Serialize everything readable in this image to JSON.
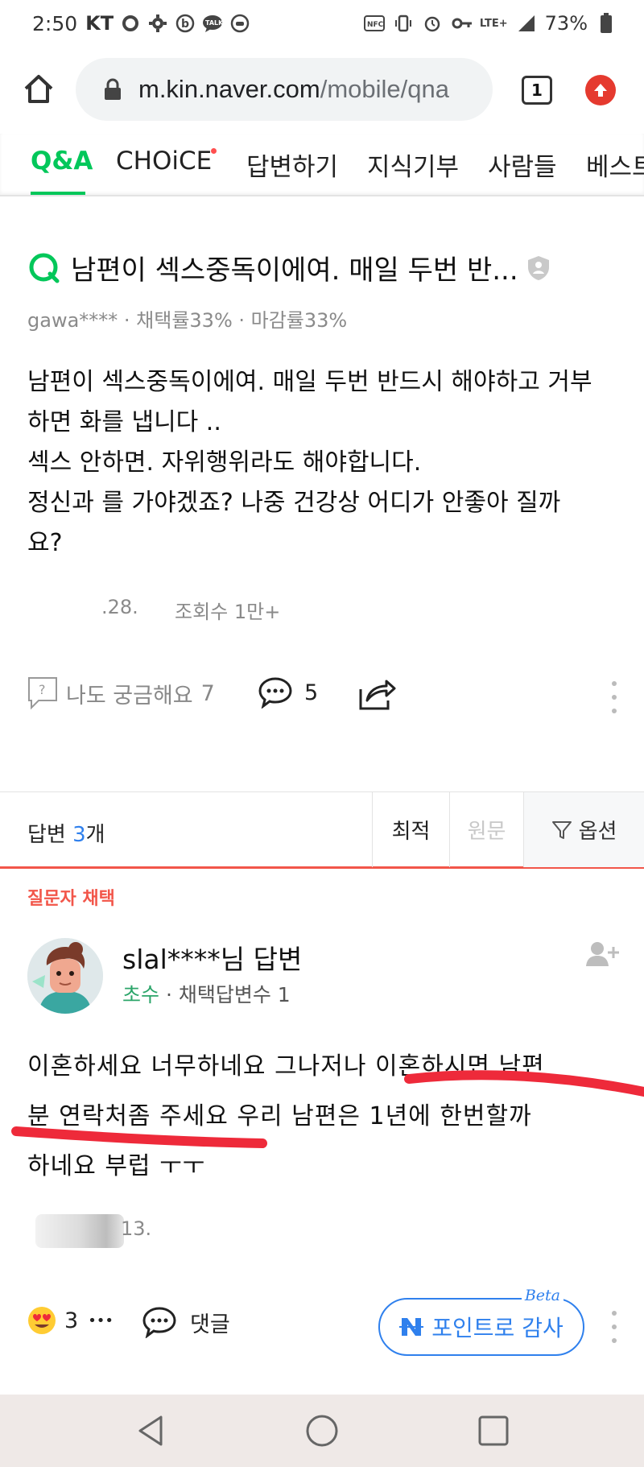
{
  "status_bar": {
    "time": "2:50",
    "carrier": "KT",
    "battery": "73%",
    "network": "LTE+"
  },
  "browser": {
    "url_host": "m.kin.naver.com",
    "url_path": "/mobile/qna",
    "tab_count": "1"
  },
  "tabs": [
    {
      "label": "Q&A"
    },
    {
      "label": "CHOiCE"
    },
    {
      "label": "답변하기"
    },
    {
      "label": "지식기부"
    },
    {
      "label": "사람들"
    },
    {
      "label": "베스트"
    }
  ],
  "question": {
    "title": "남편이 섹스중독이에여. 매일 두번 반...",
    "meta": "gawa**** · 채택률33% · 마감률33%",
    "body_lines": [
      "남편이 섹스중독이에여. 매일 두번 반드시 해야하고 거부",
      "하면 화를 냅니다 ..",
      "섹스 안하면. 자위행위라도 해야합니다.",
      "정신과 를 가야겠죠? 나중 건강상 어디가 안좋아 질까",
      "요?"
    ],
    "date_partial": ".28.",
    "views": "조회수 1만+",
    "curious_label": "나도 궁금해요",
    "curious_count": "7",
    "comment_count": "5"
  },
  "answers_header": {
    "label": "답변",
    "count": "3",
    "unit": "개",
    "sort_best": "최적",
    "sort_original": "원문",
    "options": "옵션"
  },
  "answer": {
    "adopt_label": "질문자 채택",
    "user": "slal****님 답변",
    "rank": "초수",
    "meta_rest": " · 채택답변수 1",
    "body_lines": [
      "이혼하세요  너무하네요  그나저나  이혼하시면  남편",
      "분  연락처좀  주세요  우리 남편은  1년에 한번할까",
      "하네요  부럽 ㅜㅜ"
    ],
    "date_partial": "13.",
    "reaction_count": "3",
    "reaction_more": "•••",
    "comment_label": "댓글",
    "thanks_label": "포인트로 감사",
    "beta": "Beta"
  },
  "colors": {
    "naver_green": "#03c75a",
    "accent_blue": "#2f80ed",
    "adopt_red": "#f2564a",
    "markup_red": "#ee2a3a"
  }
}
